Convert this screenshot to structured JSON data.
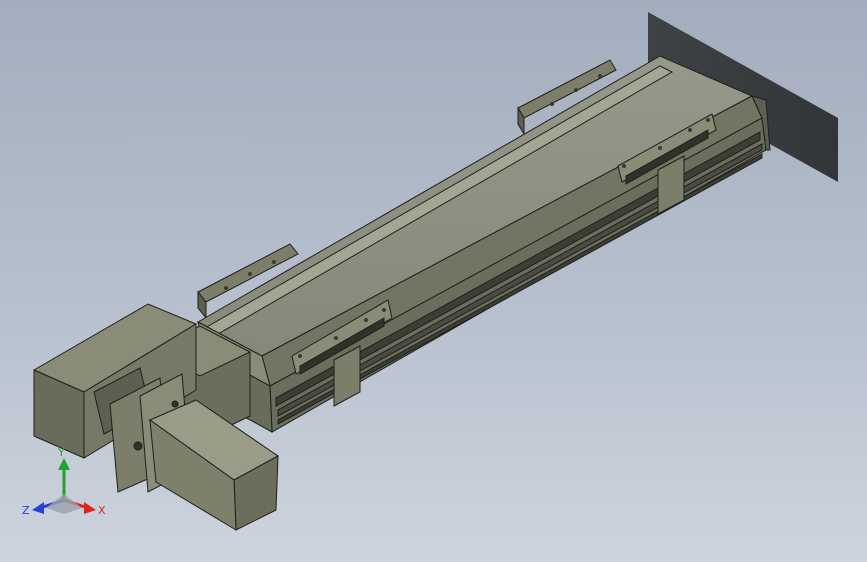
{
  "view": {
    "background_top": "#a3adbd",
    "background_bottom": "#cdd4de"
  },
  "model": {
    "body_color": "#7c7e6a",
    "top_color": "#8d8f7b",
    "dark_color": "#3d3f36",
    "edge_color": "#1e1f1a"
  },
  "triad": {
    "x_label": "X",
    "y_label": "Y",
    "z_label": "Z",
    "x_color": "#e0241b",
    "y_color": "#1fa52a",
    "z_color": "#2740d8"
  }
}
